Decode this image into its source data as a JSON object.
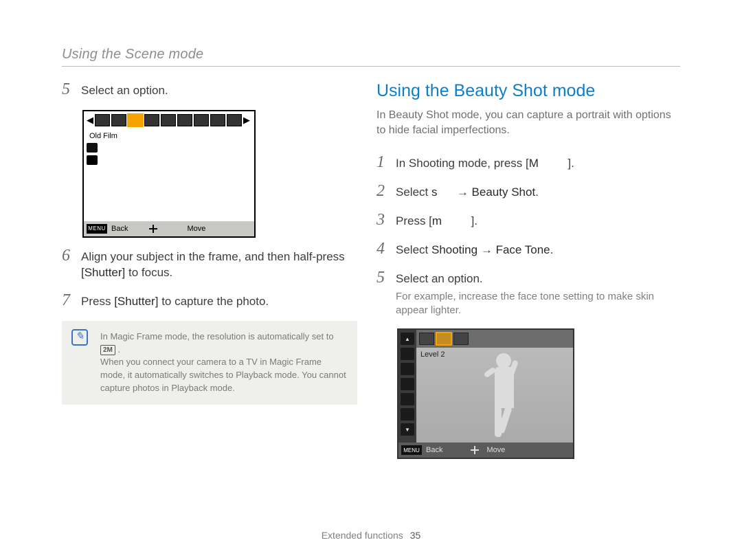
{
  "header": {
    "title": "Using the Scene mode"
  },
  "left": {
    "step5": {
      "num": "5",
      "text": "Select an option."
    },
    "lcd": {
      "thumbs_count": 9,
      "selected_index": 2,
      "label": "Old Film",
      "foot_menu": "MENU",
      "foot_back": "Back",
      "foot_move": "Move"
    },
    "step6": {
      "num": "6",
      "text_a": "Align your subject in the frame, and then half-press",
      "text_b": "[Shutter]",
      "text_c": " to focus."
    },
    "step7": {
      "num": "7",
      "text_a": "Press ",
      "text_b": "[Shutter]",
      "text_c": " to capture the photo."
    },
    "note": {
      "line1_a": "In Magic Frame mode, the resolution is automatically set to ",
      "res_label": "2M",
      "line1_b": ".",
      "line2": "When you connect your camera to a TV in Magic Frame mode, it automatically switches to Playback mode. You cannot capture photos in Playback mode."
    }
  },
  "right": {
    "heading": "Using the Beauty Shot mode",
    "intro": "In Beauty Shot mode, you can capture a portrait with options to hide facial imperfections.",
    "step1": {
      "num": "1",
      "a": "In Shooting mode, press [",
      "b": "M",
      "c": "         ]."
    },
    "step2": {
      "num": "2",
      "a": "Select ",
      "b": "s",
      "c": "      → ",
      "d": "Beauty Shot",
      "e": "."
    },
    "step3": {
      "num": "3",
      "a": "Press [",
      "b": "m",
      "c": "         ]."
    },
    "step4": {
      "num": "4",
      "a": "Select ",
      "b": "Shooting",
      "c": " → ",
      "d": "Face Tone",
      "e": "."
    },
    "step5": {
      "num": "5",
      "a": "Select an option.",
      "sub": "For example, increase the face tone setting to make skin appear lighter."
    },
    "lcd": {
      "thumbs_count": 3,
      "selected_index": 1,
      "label": "Level 2",
      "foot_menu": "MENU",
      "foot_back": "Back",
      "foot_move": "Move"
    }
  },
  "footer": {
    "section": "Extended functions",
    "page": "35"
  }
}
